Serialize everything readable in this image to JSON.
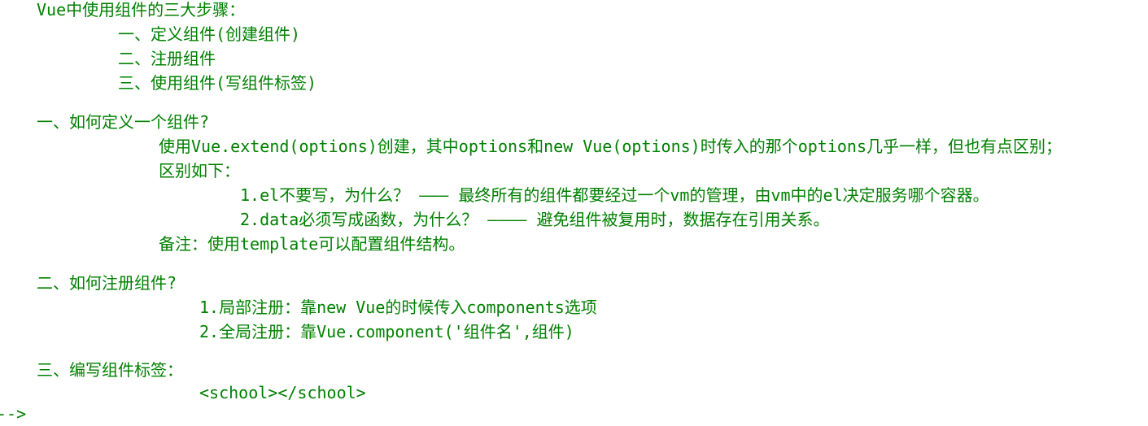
{
  "comment": {
    "title": "Vue中使用组件的三大步骤：",
    "steps": [
      "一、定义组件(创建组件)",
      "二、注册组件",
      "三、使用组件(写组件标签)"
    ],
    "define_section": {
      "heading": "一、如何定义一个组件?",
      "description": "使用Vue.extend(options)创建，其中options和new Vue(options)时传入的那个options几乎一样，但也有点区别；",
      "differences_intro": "区别如下：",
      "differences": [
        "1.el不要写，为什么？ ——— 最终所有的组件都要经过一个vm的管理，由vm中的el决定服务哪个容器。",
        "2.data必须写成函数，为什么？ ———— 避免组件被复用时，数据存在引用关系。"
      ],
      "note": "备注：使用template可以配置组件结构。"
    },
    "register_section": {
      "heading": "二、如何注册组件?",
      "methods": [
        "1.局部注册：靠new Vue的时候传入components选项",
        "2.全局注册：靠Vue.component('组件名',组件)"
      ]
    },
    "tag_section": {
      "heading": "三、编写组件标签：",
      "example": "<school></school>"
    },
    "closing": "-->"
  },
  "colors": {
    "comment_text": "#008000",
    "background": "#ffffff"
  }
}
